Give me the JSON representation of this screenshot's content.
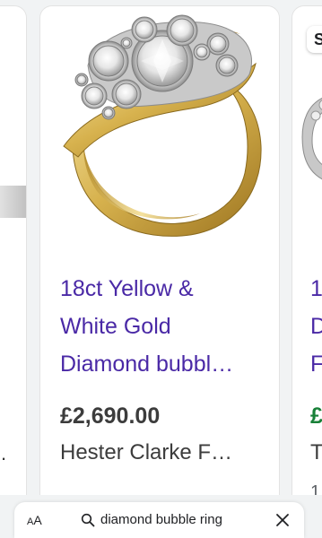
{
  "cards": {
    "left": {
      "trailing_text": "."
    },
    "main": {
      "title_lines": [
        "18ct Yellow &",
        "White Gold",
        "Diamond bubbl…"
      ],
      "price": "£2,690.00",
      "seller": "Hester Clarke F…",
      "image_icon": "diamond-ring-image"
    },
    "right": {
      "badge": "S",
      "title_lines": [
        "1",
        "D",
        "F"
      ],
      "price": "£",
      "seller": "T",
      "extra": "1"
    }
  },
  "address_bar": {
    "text_size_label_small": "A",
    "text_size_label_large": "A",
    "query": "diamond bubble ring"
  },
  "colors": {
    "title": "#4a29a6",
    "price": "#3c3c3c",
    "right_price": "#188038",
    "background": "#f1f3f4"
  }
}
